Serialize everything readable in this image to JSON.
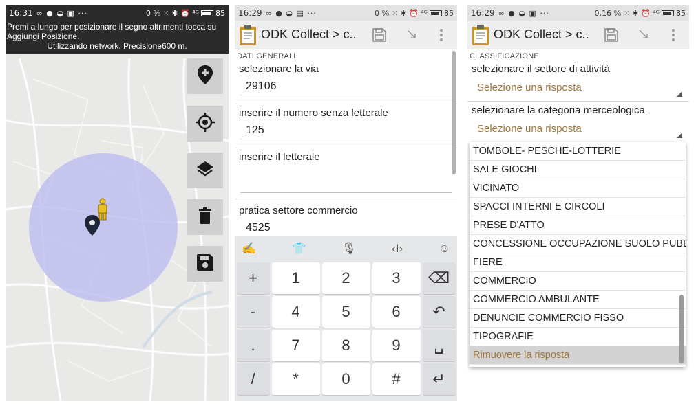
{
  "panel1": {
    "status": {
      "time": "16:31",
      "icons": "∞ ● ◒ ▣ ···",
      "right": "0 ⁰⁄₀ ⁙ ✱ ⏰ ⁴ᴳ",
      "battery": "85"
    },
    "info_line1": "Premi a lungo per posizionare il segno altrimenti tocca su Aggiungi Posizione.",
    "info_line2": "Utilizzando network. Precisione600 m."
  },
  "panel2": {
    "status": {
      "time": "16:29",
      "icons": "∞ ● ◒ ▤ ···",
      "right": "0 ⁰⁄₀ ⁙ ✱ ⏰ ⁴ᴳ",
      "battery": "85"
    },
    "toolbar_title": "ODK Collect > c..",
    "section": "DATI GENERALI",
    "q1": "selezionare la via",
    "a1": "29106",
    "q2": "inserire il numero senza letterale",
    "a2": "125",
    "q3": "inserire il letterale",
    "a3": "",
    "q4": "pratica settore commercio",
    "a4": "4525",
    "keyboard": {
      "rows": [
        [
          "+",
          "1",
          "2",
          "3",
          "⌫"
        ],
        [
          "-",
          "4",
          "5",
          "6",
          "↶"
        ],
        [
          ".",
          "7",
          "8",
          "9",
          "␣"
        ],
        [
          "/",
          "*",
          "0",
          "#",
          "↵"
        ]
      ]
    }
  },
  "panel3": {
    "status": {
      "time": "16:29",
      "icons": "∞ ● ◒ ▣ ···",
      "right": "0,16 ⁰⁄₀ ⁙ ✱ ⏰ ⁴ᴳ",
      "battery": "85"
    },
    "toolbar_title": "ODK Collect > c..",
    "section": "CLASSIFICAZIONE",
    "q1": "selezionare il settore di attività",
    "sel1": "Selezione una risposta",
    "q2": "selezionare la categoria merceologica",
    "sel2": "Selezione una risposta",
    "dropdown": [
      "TOMBOLE- PESCHE-LOTTERIE",
      "SALE GIOCHI",
      "VICINATO",
      "SPACCI INTERNI E CIRCOLI",
      "PRESE D'ATTO",
      "CONCESSIONE OCCUPAZIONE SUOLO PUBBLICO",
      "FIERE",
      "COMMERCIO",
      "COMMERCIO AMBULANTE",
      "DENUNCIE COMMERCIO FISSO",
      "TIPOGRAFIE"
    ],
    "remove_label": "Rimuovere la risposta"
  },
  "colors": {
    "accent": "#4aa8c9",
    "hint": "#a0783c",
    "accuracy_circle": "#b8b8f0"
  },
  "icons": [
    "add-location-icon",
    "my-location-icon",
    "layers-icon",
    "delete-icon",
    "save-icon",
    "pegman-icon",
    "map-pin-icon",
    "clipboard-icon",
    "save-form-icon",
    "next-icon",
    "overflow-menu-icon"
  ]
}
